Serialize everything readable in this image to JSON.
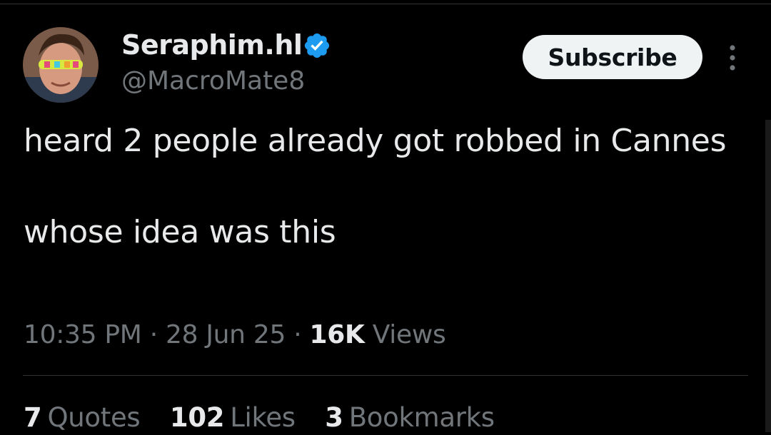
{
  "author": {
    "display_name": "Seraphim.hl",
    "handle": "@MacroMate8",
    "verified": true,
    "verified_color": "#1d9bf0"
  },
  "subscribe_label": "Subscribe",
  "tweet": {
    "line1": "heard 2 people already got robbed in Cannes",
    "line2": "whose idea was this"
  },
  "meta": {
    "time": "10:35 PM",
    "sep1": " · ",
    "date": "28 Jun 25",
    "sep2": " · ",
    "views_count": "16K",
    "views_label": " Views"
  },
  "stats": {
    "quotes_count": "7",
    "quotes_label": "Quotes",
    "likes_count": "102",
    "likes_label": "Likes",
    "bookmarks_count": "3",
    "bookmarks_label": "Bookmarks"
  },
  "colors": {
    "background": "#000000",
    "primary_text": "#e7e9ea",
    "secondary_text": "#71767b",
    "divider": "#2f3336"
  },
  "icons": {
    "verified": "verified-badge-icon",
    "more": "more-options-icon"
  }
}
